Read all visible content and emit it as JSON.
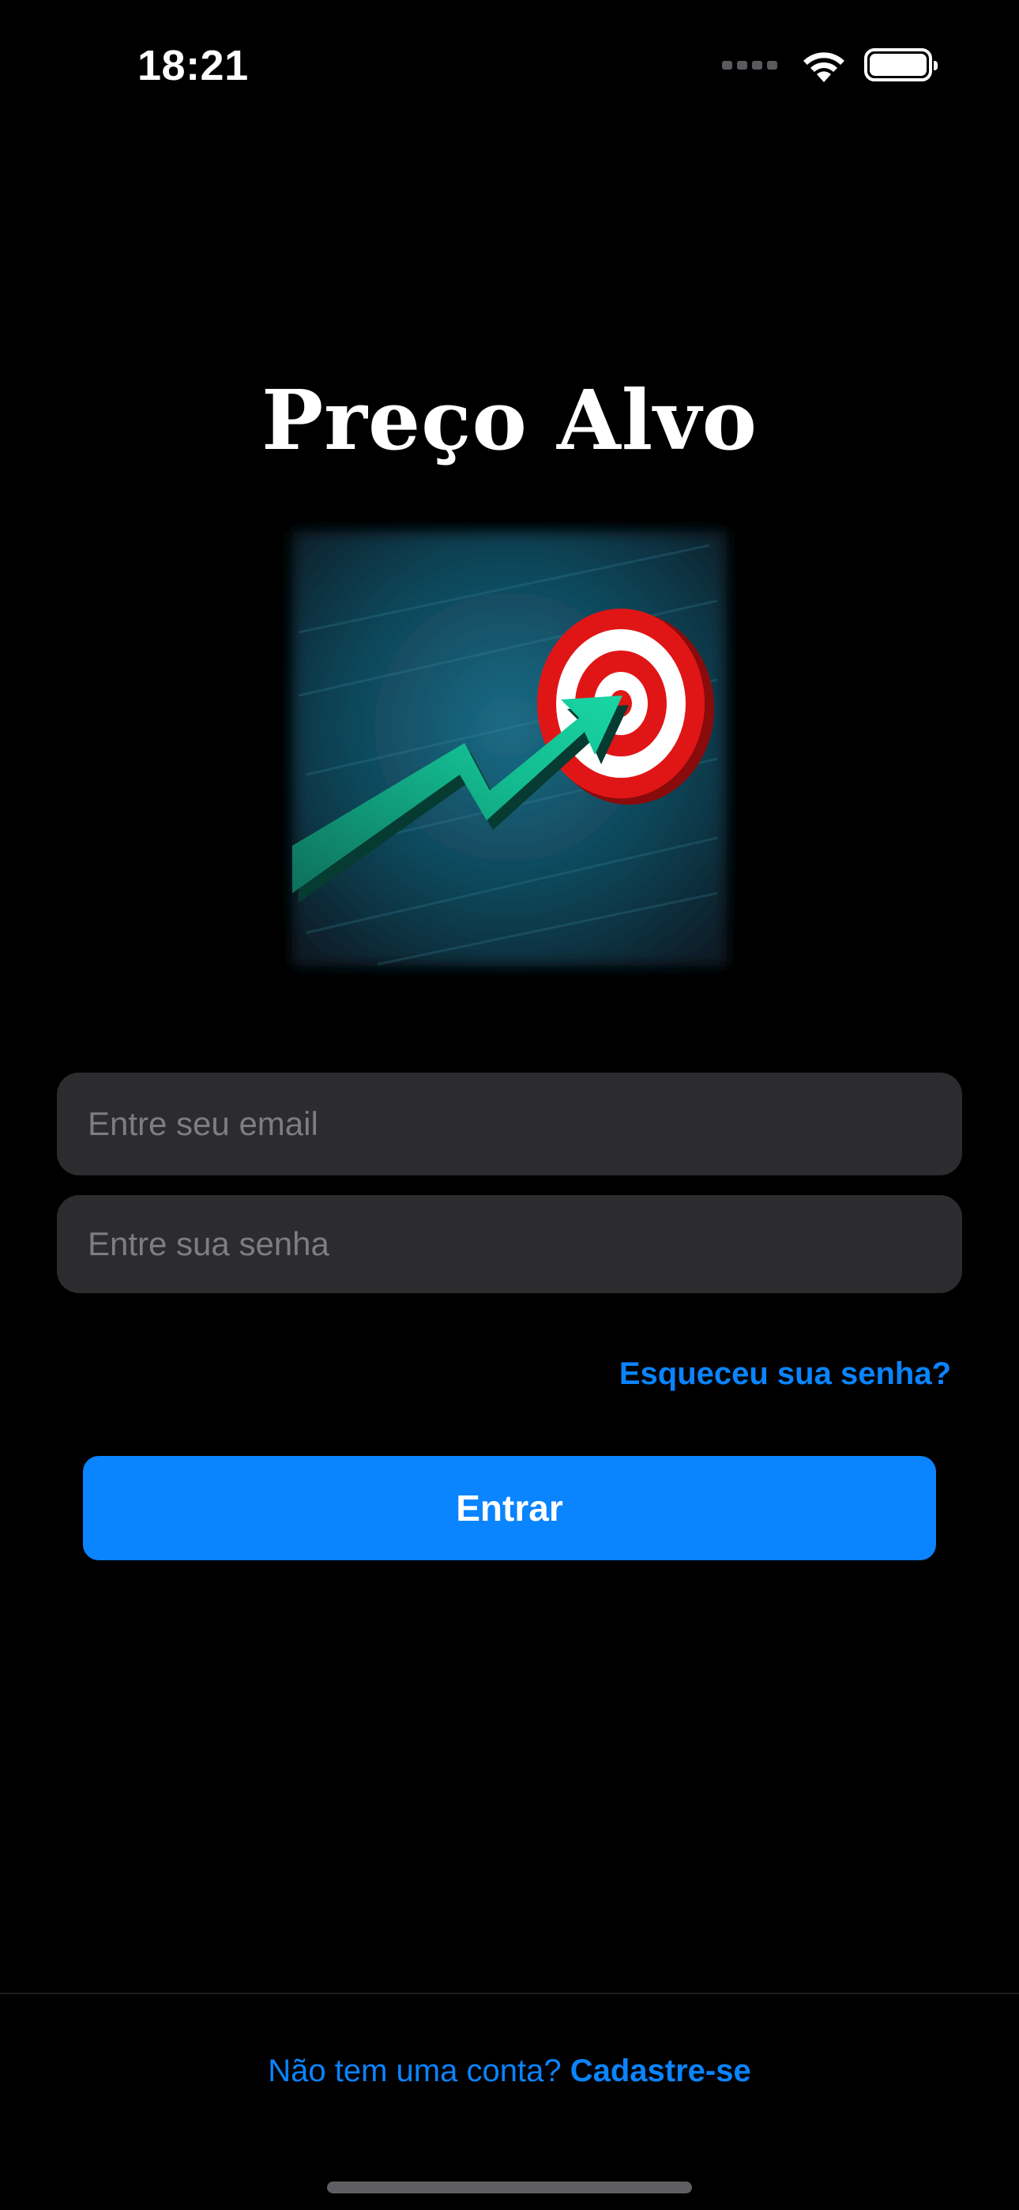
{
  "status_bar": {
    "time": "18:21",
    "icons": [
      "cellular-signal-icon",
      "wifi-icon",
      "battery-icon"
    ]
  },
  "app": {
    "title": "Preço Alvo",
    "logo_icon": "target-arrow-logo-icon"
  },
  "login_form": {
    "email_placeholder": "Entre seu email",
    "email_value": "",
    "password_placeholder": "Entre sua senha",
    "password_value": "",
    "forgot_password_label": "Esqueceu sua senha?",
    "submit_label": "Entrar"
  },
  "footer": {
    "no_account_text": "Não tem uma conta?",
    "signup_label": "Cadastre-se"
  },
  "colors": {
    "background": "#000000",
    "accent": "#0A84FF",
    "field_background": "#2C2C2E",
    "placeholder": "#7D7D82"
  }
}
